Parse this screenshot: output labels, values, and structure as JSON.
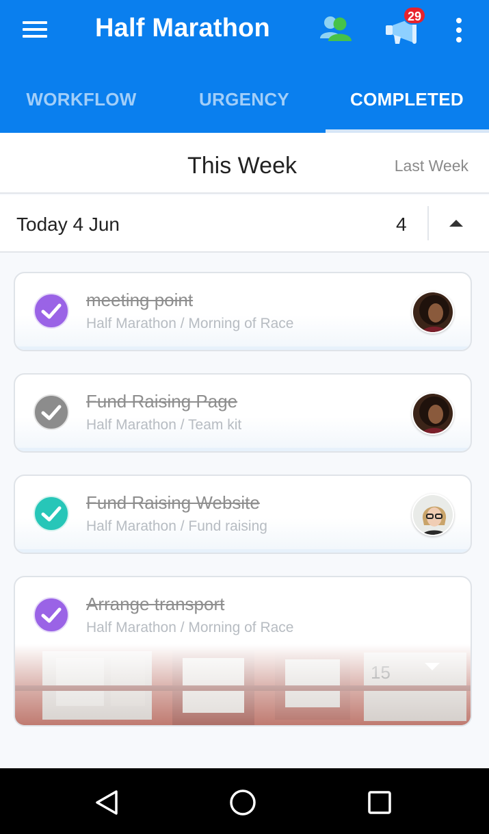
{
  "app": {
    "title": "Half Marathon",
    "notification_count": "29",
    "accent_color": "#0a7fee"
  },
  "tabs": [
    {
      "label": "WORKFLOW",
      "active": false
    },
    {
      "label": "URGENCY",
      "active": false
    },
    {
      "label": "COMPLETED",
      "active": true
    }
  ],
  "week": {
    "current": "This Week",
    "previous": "Last Week"
  },
  "day": {
    "label": "Today 4 Jun",
    "count": "4"
  },
  "tasks": [
    {
      "title": "meeting point",
      "path": "Half Marathon / Morning of Race",
      "check_color": "#9a63e6",
      "avatar": "avatar-woman-curly-hair"
    },
    {
      "title": "Fund Raising Page",
      "path": "Half Marathon / Team kit",
      "check_color": "#8c8c8c",
      "avatar": "avatar-woman-curly-hair"
    },
    {
      "title": "Fund Raising Website",
      "path": "Half Marathon / Fund raising",
      "check_color": "#27c6b8",
      "avatar": "avatar-woman-glasses"
    },
    {
      "title": "Arrange transport",
      "path": "Half Marathon / Morning of Race",
      "check_color": "#9a63e6",
      "cover": "red-bus-photo"
    }
  ],
  "bus_route_number": "15",
  "icons": {
    "menu": "hamburger-menu-icon",
    "team": "people-icon",
    "announcements": "megaphone-icon",
    "more": "more-vertical-icon",
    "collapse": "triangle-up-icon",
    "expand": "triangle-down-icon",
    "nav_back": "back-triangle-icon",
    "nav_home": "home-circle-icon",
    "nav_recent": "recent-square-icon"
  }
}
